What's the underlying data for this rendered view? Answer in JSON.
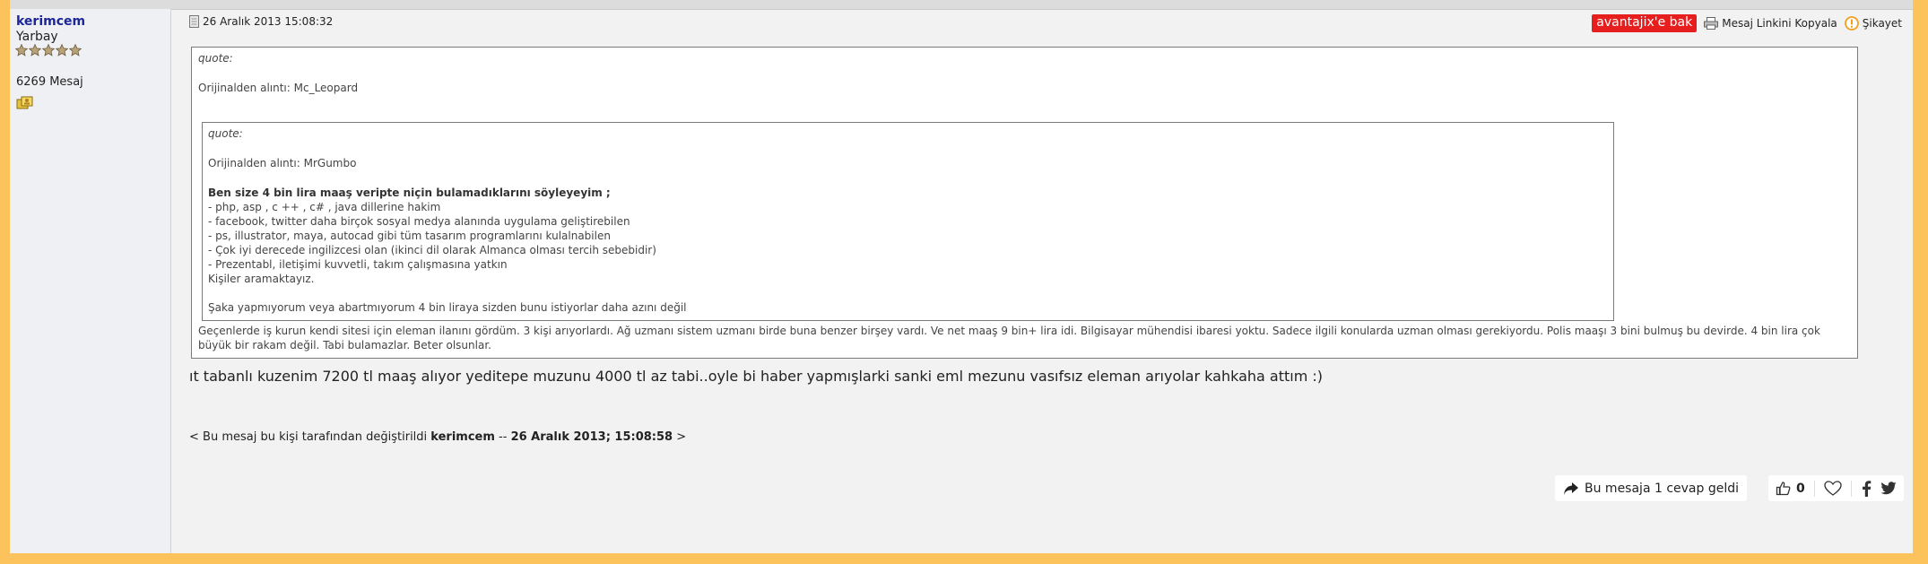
{
  "user": {
    "name": "kerimcem",
    "rank": "Yarbay",
    "stars": 5,
    "post_count": "6269 Mesaj",
    "badge_icon": "group-badge-icon"
  },
  "post": {
    "date": "26 Aralık 2013 15:08:32",
    "promo_label": "avantajix'e bak",
    "copy_link_label": "Mesaj Linkini Kopyala",
    "report_label": "Şikayet",
    "outer_quote": {
      "label": "quote:",
      "source": "Orijinalden alıntı: Mc_Leopard",
      "comment": "Geçenlerde iş kurun kendi sitesi için eleman ilanını gördüm. 3 kişi arıyorlardı. Ağ uzmanı sistem uzmanı birde buna benzer birşey vardı. Ve net maaş 9 bin+ lira idi. Bilgisayar mühendisi ibaresi yoktu. Sadece ilgili konularda uzman olması gerekiyordu. Polis maaşı 3 bini bulmuş bu devirde. 4 bin lira çok büyük bir rakam değil. Tabi bulamazlar. Beter olsunlar."
    },
    "inner_quote": {
      "label": "quote:",
      "source": "Orijinalden alıntı: MrGumbo",
      "heading": "Ben size 4 bin lira maaş veripte niçin bulamadıklarını söyleyeyim ;",
      "lines": [
        "- php, asp , c ++ , c# , java dillerine hakim",
        "- facebook, twitter daha birçok sosyal medya alanında uygulama geliştirebilen",
        "- ps, illustrator, maya, autocad gibi tüm tasarım programlarını kulalnabilen",
        "- Çok iyi derecede ingilizcesi olan (ikinci dil olarak Almanca olması tercih sebebidir)",
        "- Prezentabl, iletişimi kuvvetli, takım çalışmasına yatkın",
        "Kişiler aramaktayız."
      ],
      "closing": "Şaka yapmıyorum veya abartmıyorum 4 bin liraya sizden bunu istiyorlar daha azını değil"
    },
    "body": "ıt tabanlı kuzenim 7200 tl maaş alıyor yeditepe muzunu 4000 tl az tabi..oyle bi haber yapmışlarki sanki eml mezunu vasıfsız eleman arıyolar kahkaha attım :)",
    "edit_note": {
      "prefix": "< Bu mesaj bu kişi tarafından değiştirildi ",
      "user": "kerimcem",
      "separator": " -- ",
      "date": "26 Aralık 2013; 15:08:58",
      "suffix": " >"
    },
    "replies_label": "Bu mesaja 1 cevap geldi",
    "like_count": "0"
  },
  "colors": {
    "page_border": "#fcc35c",
    "username": "#1c2699",
    "promo_bg": "#e71e1e",
    "report_icon": "#f0a020"
  }
}
